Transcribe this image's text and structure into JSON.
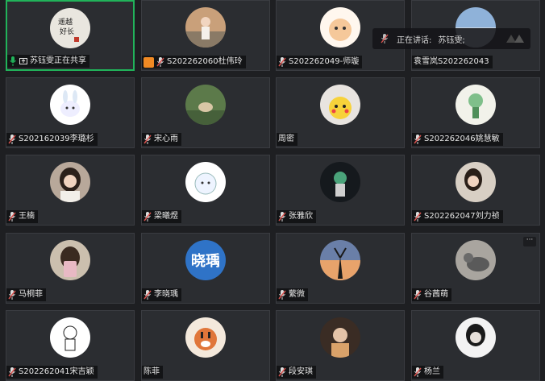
{
  "speaking_banner": {
    "label": "正在讲话:",
    "name": "苏钰雯;"
  },
  "tiles": [
    {
      "name": "苏钰雯正在共享",
      "avatar": "calligraphy",
      "active": true,
      "muted": false,
      "sharing": true
    },
    {
      "name": "S202262060杜伟玲",
      "avatar": "photo-person-outdoor",
      "muted": true,
      "user_badge": true
    },
    {
      "name": "S202262049-师璇",
      "avatar": "cartoon-cat"
    },
    {
      "name": "袁雪岚S202262043",
      "avatar": "sky-photo",
      "no_mic": true
    },
    {
      "name": "S202162039李璐杉",
      "avatar": "white-rabbit"
    },
    {
      "name": "宋心雨",
      "avatar": "deer-photo"
    },
    {
      "name": "周密",
      "avatar": "pikachu",
      "no_mic": true
    },
    {
      "name": "S202262046姚慧敏",
      "avatar": "green-plant"
    },
    {
      "name": "王楠",
      "avatar": "photo-woman"
    },
    {
      "name": "梁曦煜",
      "avatar": "cartoon-sheep"
    },
    {
      "name": "张雅欣",
      "avatar": "astronaut-color"
    },
    {
      "name": "S202262047刘力祯",
      "avatar": "photo-girl"
    },
    {
      "name": "马桐菲",
      "avatar": "photo-phone"
    },
    {
      "name": "李晓瑀",
      "avatar": "initials",
      "initials": "晓瑀"
    },
    {
      "name": "蘩微",
      "avatar": "sunset-silhouette"
    },
    {
      "name": "谷茜萌",
      "avatar": "cat-photo",
      "has_more": true
    },
    {
      "name": "S202262041宋吉颖",
      "avatar": "astronaut-sketch"
    },
    {
      "name": "陈菲",
      "avatar": "tiger-cartoon",
      "no_mic": true
    },
    {
      "name": "段安琪",
      "avatar": "photo-dark"
    },
    {
      "name": "杨兰",
      "avatar": "photo-bw"
    }
  ],
  "colors": {
    "active_border": "#21b35a",
    "tile_bg": "#2b2d31",
    "muted_red": "#d9534f",
    "initials_bg": "#2f73c7"
  }
}
